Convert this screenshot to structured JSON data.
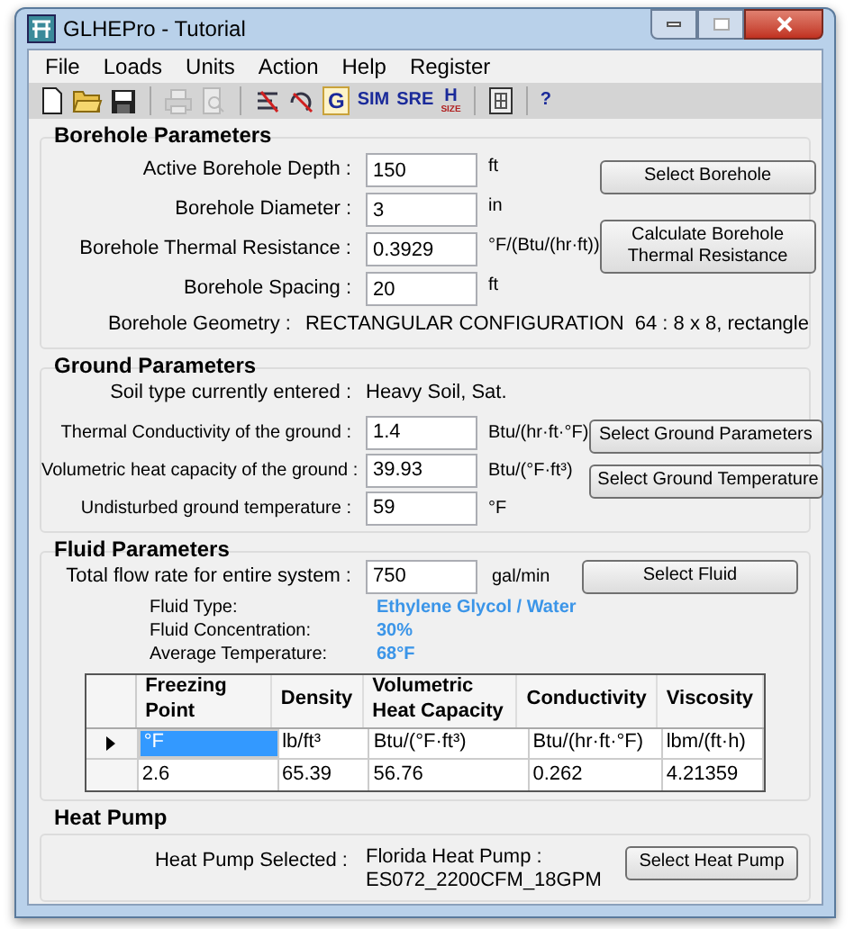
{
  "window": {
    "title": "GLHEPro - Tutorial"
  },
  "menu": [
    "File",
    "Loads",
    "Units",
    "Action",
    "Help",
    "Register"
  ],
  "toolbar": [
    {
      "kind": "new",
      "disabled": false
    },
    {
      "kind": "open",
      "disabled": false
    },
    {
      "kind": "save",
      "disabled": false
    },
    {
      "kind": "separator"
    },
    {
      "kind": "print",
      "disabled": true
    },
    {
      "kind": "preview",
      "disabled": true
    },
    {
      "kind": "separator"
    },
    {
      "kind": "lines",
      "disabled": false
    },
    {
      "kind": "curve",
      "disabled": false
    },
    {
      "kind": "text",
      "label": "G",
      "boxed": true,
      "disabled": false
    },
    {
      "kind": "text",
      "label": "SIM",
      "boxed": false,
      "disabled": false
    },
    {
      "kind": "text",
      "label": "SRE",
      "boxed": false,
      "disabled": false
    },
    {
      "kind": "text",
      "label": "H",
      "sub": "SIZE",
      "boxed": false,
      "disabled": false
    },
    {
      "kind": "separator"
    },
    {
      "kind": "grid",
      "disabled": false
    },
    {
      "kind": "separator"
    },
    {
      "kind": "text",
      "label": "?",
      "boxed": false,
      "disabled": false
    }
  ],
  "borehole": {
    "title": "Borehole Parameters",
    "rows": [
      {
        "label": "Active Borehole Depth :",
        "value": "150",
        "unit": "ft"
      },
      {
        "label": "Borehole Diameter :",
        "value": "3",
        "unit": "in"
      },
      {
        "label": "Borehole Thermal Resistance :",
        "value": "0.3929",
        "unit": "°F/(Btu/(hr·ft))"
      },
      {
        "label": "Borehole Spacing :",
        "value": "20",
        "unit": "ft"
      }
    ],
    "geometry": {
      "label": "Borehole Geometry :",
      "value": "RECTANGULAR CONFIGURATION  64 : 8 x 8, rectangle"
    },
    "buttons": [
      "Select Borehole",
      "Calculate Borehole Thermal Resistance"
    ]
  },
  "ground": {
    "title": "Ground Parameters",
    "soil": {
      "label": "Soil type currently entered :",
      "value": "Heavy Soil, Sat."
    },
    "rows": [
      {
        "label": "Thermal Conductivity of the ground :",
        "value": "1.4",
        "unit": "Btu/(hr·ft·°F)"
      },
      {
        "label": "Volumetric heat capacity of the ground :",
        "value": "39.93",
        "unit": "Btu/(°F·ft³)"
      },
      {
        "label": "Undisturbed ground temperature :",
        "value": "59",
        "unit": "°F"
      }
    ],
    "buttons": [
      "Select Ground Parameters",
      "Select Ground Temperature"
    ]
  },
  "fluid": {
    "title": "Fluid Parameters",
    "flow": {
      "label": "Total flow rate for entire system :",
      "value": "750",
      "unit": "gal/min"
    },
    "button": "Select Fluid",
    "info": [
      {
        "label": "Fluid Type:",
        "value": "Ethylene Glycol / Water"
      },
      {
        "label": "Fluid Concentration:",
        "value": "30%"
      },
      {
        "label": "Average Temperature:",
        "value": "68°F"
      }
    ],
    "table": {
      "columns": [
        "Freezing Point",
        "Density",
        "Volumetric Heat Capacity",
        "Conductivity",
        "Viscosity"
      ],
      "rows": [
        {
          "selected": true,
          "cells": [
            "°F",
            "lb/ft³",
            "Btu/(°F·ft³)",
            "Btu/(hr·ft·°F)",
            "lbm/(ft·h)"
          ]
        },
        {
          "selected": false,
          "cells": [
            "2.6",
            "65.39",
            "56.76",
            "0.262",
            "4.21359"
          ]
        }
      ]
    }
  },
  "heat_pump": {
    "title": "Heat Pump",
    "label": "Heat Pump Selected :",
    "value_lines": [
      "Florida Heat Pump :",
      "ES072_2200CFM_18GPM"
    ],
    "button": "Select Heat Pump"
  }
}
